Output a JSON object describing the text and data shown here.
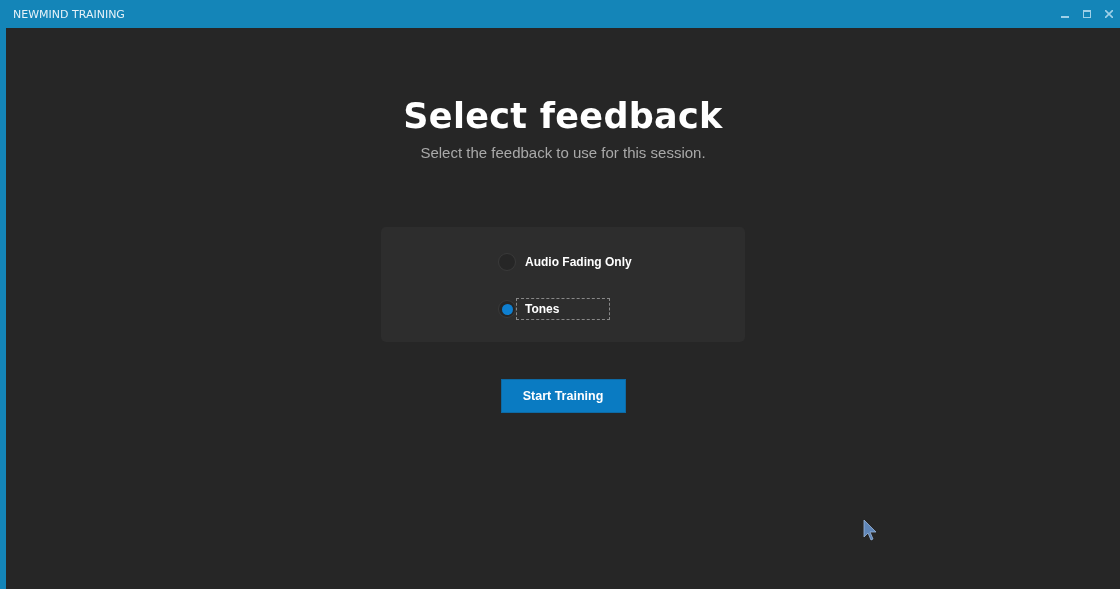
{
  "window": {
    "title": "NEWMIND TRAINING"
  },
  "heading": "Select feedback",
  "subtitle": "Select the feedback to use for this session.",
  "options": [
    {
      "label": "Audio Fading Only",
      "selected": false,
      "focused": false
    },
    {
      "label": "Tones",
      "selected": true,
      "focused": true
    }
  ],
  "buttons": [
    "Start Training"
  ]
}
